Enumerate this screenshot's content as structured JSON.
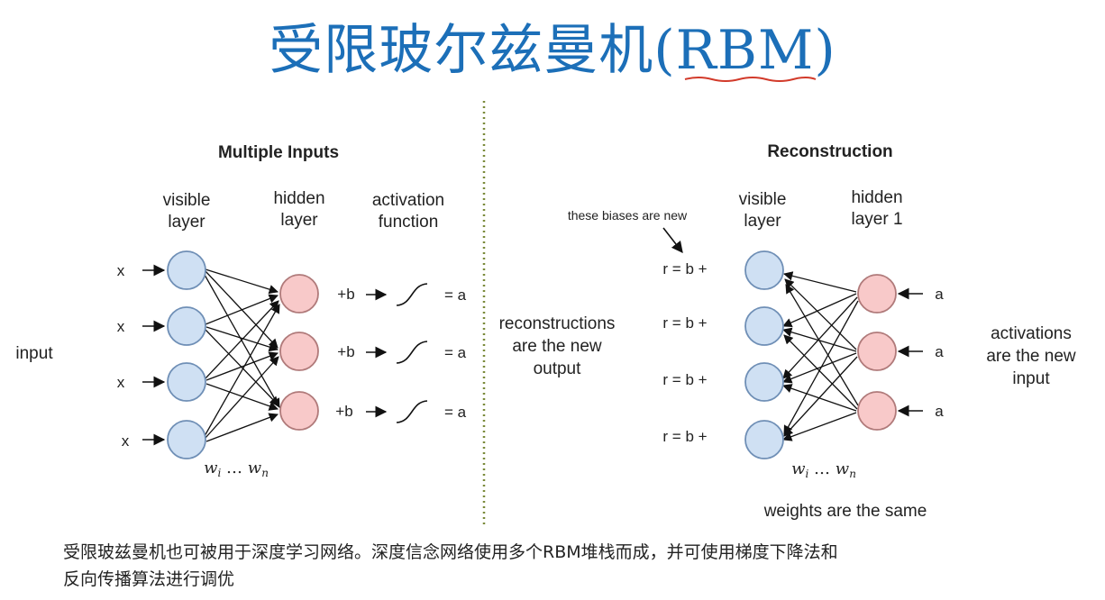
{
  "title": "受限玻尔兹曼机(RBM)",
  "left_panel": {
    "heading": "Multiple Inputs",
    "visible_layer": [
      "visible",
      "layer"
    ],
    "hidden_layer": [
      "hidden",
      "layer"
    ],
    "activation_function": [
      "activation",
      "function"
    ],
    "input_marks": [
      "x",
      "x",
      "x",
      "x"
    ],
    "side_label": "input",
    "bias_terms": [
      "+b",
      "+b",
      "+b"
    ],
    "outputs": [
      "= a",
      "= a",
      "= a"
    ],
    "weights": {
      "w": "w",
      "sub_i": "i",
      "dots": " … ",
      "sub_n": "n"
    }
  },
  "right_panel": {
    "heading": "Reconstruction",
    "visible_layer": [
      "visible",
      "layer"
    ],
    "hidden_layer": [
      "hidden",
      "layer 1"
    ],
    "bias_note": "these biases are new",
    "r_terms": [
      "r = b +",
      "r = b +",
      "r = b +",
      "r = b +"
    ],
    "hidden_inputs": [
      "a",
      "a",
      "a"
    ],
    "left_label": [
      "reconstructions",
      "are the new",
      "output"
    ],
    "right_label": [
      "activations",
      "are the new",
      "input"
    ],
    "weights": {
      "w": "w",
      "sub_i": "i",
      "dots": " … ",
      "sub_n": "n"
    },
    "weights_note": "weights are the same"
  },
  "caption": [
    "受限玻兹曼机也可被用于深度学习网络。深度信念网络使用多个RBM堆栈而成，并可使用梯度下降法和",
    "反向传播算法进行调优"
  ],
  "colors": {
    "title": "#1c6fb8",
    "visible_node_fill": "#cfe0f3",
    "visible_node_stroke": "#6f8fb6",
    "hidden_node_fill": "#f8c9c9",
    "hidden_node_stroke": "#b07a7a",
    "divider": "#7a8a3a",
    "underline": "#d23a2a"
  }
}
